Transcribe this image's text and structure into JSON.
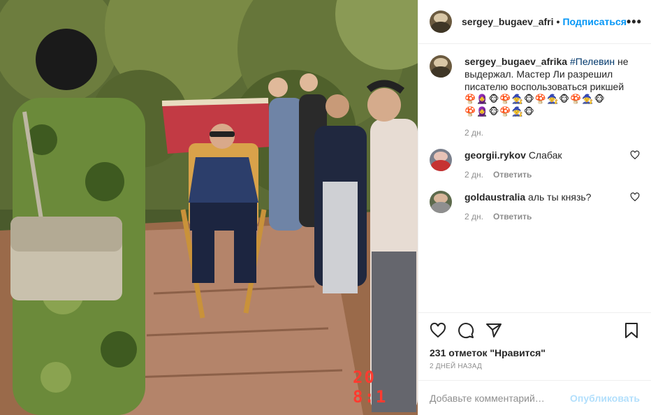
{
  "header": {
    "username": "sergey_bugaev_afri",
    "separator": "•",
    "follow_label": "Подписаться",
    "more_icon": "more-horizontal-icon"
  },
  "photo": {
    "date_stamp": "20   8:1"
  },
  "caption": {
    "username": "sergey_bugaev_afrika",
    "hashtag": "#Пелевин",
    "text": " не выдержал. Мастер Ли разрешил писателю воспользоваться рикшей",
    "emoji_line_1": "🍄🧕🐵🍄🧙🐵🍄🧙🐵🍄🧙🐵",
    "emoji_line_2": "🍄🧕🐵🍄🧙🐵",
    "time": "2 дн."
  },
  "comments": [
    {
      "username": "georgii.rykov",
      "text": "Слабак",
      "time": "2 дн.",
      "reply_label": "Ответить"
    },
    {
      "username": "goldaustralia",
      "text": "аль ты князь?",
      "time": "2 дн.",
      "reply_label": "Ответить"
    }
  ],
  "actions": {
    "like_icon": "heart-icon",
    "comment_icon": "comment-icon",
    "share_icon": "paper-plane-icon",
    "save_icon": "bookmark-icon"
  },
  "likes_text": "231 отметок \"Нравится\"",
  "post_date": "2 ДНЕЙ НАЗАД",
  "add_comment": {
    "placeholder": "Добавьте комментарий…",
    "publish_label": "Опубликовать"
  },
  "colors": {
    "link_blue": "#0095f6",
    "publish_disabled": "#b2dffc",
    "muted": "#8e8e8e"
  }
}
